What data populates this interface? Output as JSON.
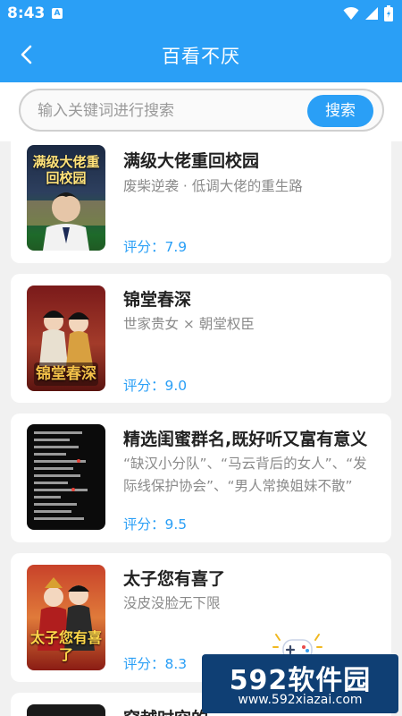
{
  "status_bar": {
    "time": "8:43",
    "notification": "A"
  },
  "app_bar": {
    "title": "百看不厌"
  },
  "search": {
    "placeholder": "输入关键词进行搜索",
    "value": "",
    "button_label": "搜索"
  },
  "books": [
    {
      "title": "满级大佬重回校园",
      "description": "废柴逆袭 · 低调大佬的重生路",
      "score": "评分：7.9",
      "cover_text": "满级大佬重回校园"
    },
    {
      "title": "锦堂春深",
      "description": "世家贵女 × 朝堂权臣",
      "score": "评分：9.0",
      "cover_text": "锦堂春深"
    },
    {
      "title": "精选闺蜜群名,既好听又富有意义",
      "description": "“缺汉小分队”、“马云背后的女人”、“发际线保护协会”、“男人常换姐妹不散”",
      "score": "评分：9.5",
      "cover_text": ""
    },
    {
      "title": "太子您有喜了",
      "description": "没皮没脸无下限",
      "score": "评分：8.3",
      "cover_text": "太子您有喜了"
    },
    {
      "title": "穿越时空的",
      "description": "",
      "score": "",
      "cover_text": ""
    }
  ],
  "watermark": {
    "logo": "592软件园",
    "url": "www.592xiazai.com"
  },
  "colors": {
    "accent": "#2a9ff6",
    "card_bg": "#ffffff",
    "page_bg": "#f1f1f1"
  }
}
